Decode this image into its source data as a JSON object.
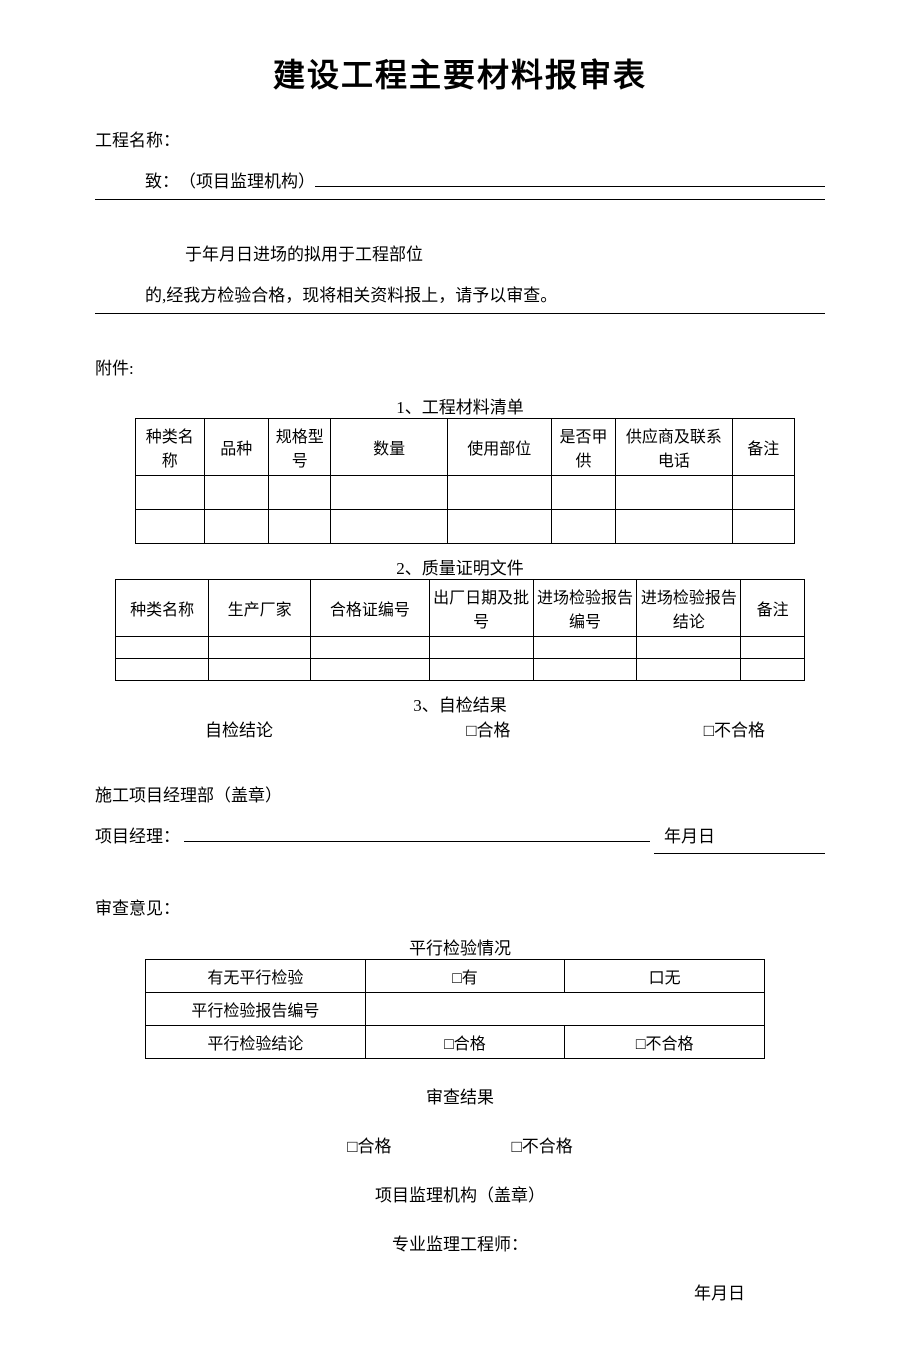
{
  "title": "建设工程主要材料报审表",
  "project_label": "工程名称：",
  "to_prefix": "致：",
  "to_org": "（项目监理机构）",
  "para1": "于年月日进场的拟用于工程部位",
  "para2": "的,经我方检验合格，现将相关资料报上，请予以审查。",
  "attachment_label": "附件:",
  "section1_title": "1、工程材料清单",
  "tbl1_headers": [
    "种类名称",
    "品种",
    "规格型号",
    "数量",
    "使用部位",
    "是否甲供",
    "供应商及联系电话",
    "备注"
  ],
  "section2_title": "2、质量证明文件",
  "tbl2_headers": [
    "种类名称",
    "生产厂家",
    "合格证编号",
    "出厂日期及批号",
    "进场检验报告编号",
    "进场检验报告结论",
    "备注"
  ],
  "section3_title": "3、自检结果",
  "self_check_label": "自检结论",
  "pass": "□合格",
  "fail": "□不合格",
  "contractor_seal": "施工项目经理部（盖章）",
  "pm_label": "项目经理：",
  "date_ymd": "年月日",
  "review_opinion": "审查意见：",
  "parallel_title": "平行检验情况",
  "tbl3_rows": [
    [
      "有无平行检验",
      "□有",
      "口无"
    ],
    [
      "平行检验报告编号",
      "",
      ""
    ],
    [
      "平行检验结论",
      "□合格",
      "□不合格"
    ]
  ],
  "review_result": "审查结果",
  "supervisor_org": "项目监理机构（盖章）",
  "pro_engineer": "专业监理工程师："
}
